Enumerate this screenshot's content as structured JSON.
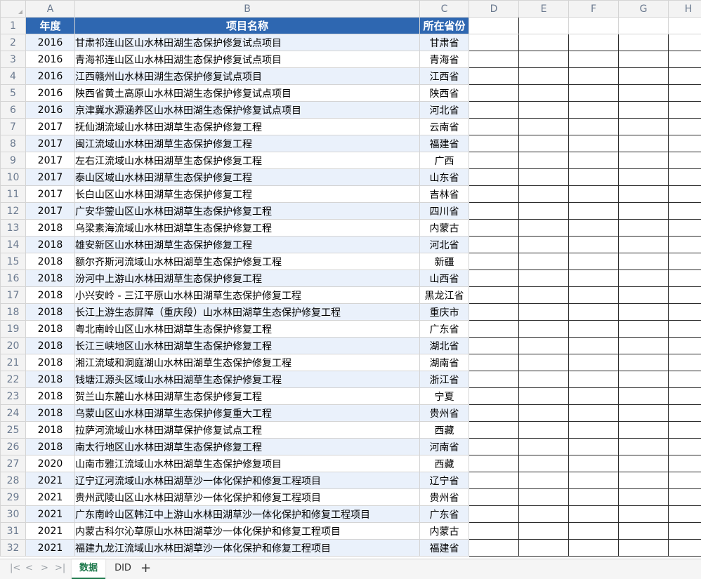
{
  "columns": [
    "A",
    "B",
    "C",
    "D",
    "E",
    "F",
    "G",
    "H"
  ],
  "headers": {
    "year": "年度",
    "name": "项目名称",
    "province": "所在省份"
  },
  "rows": [
    {
      "n": "2",
      "year": "2016",
      "name": "甘肃祁连山区山水林田湖生态保护修复试点项目",
      "province": "甘肃省"
    },
    {
      "n": "3",
      "year": "2016",
      "name": "青海祁连山区山水林田湖生态保护修复试点项目",
      "province": "青海省"
    },
    {
      "n": "4",
      "year": "2016",
      "name": "江西赣州山水林田湖生态保护修复试点项目",
      "province": "江西省"
    },
    {
      "n": "5",
      "year": "2016",
      "name": "陕西省黄土高原山水林田湖生态保护修复试点项目",
      "province": "陕西省"
    },
    {
      "n": "6",
      "year": "2016",
      "name": "京津冀水源涵养区山水林田湖生态保护修复试点项目",
      "province": "河北省"
    },
    {
      "n": "7",
      "year": "2017",
      "name": "抚仙湖流域山水林田湖草生态保护修复工程",
      "province": "云南省"
    },
    {
      "n": "8",
      "year": "2017",
      "name": "闽江流域山水林田湖草生态保护修复工程",
      "province": "福建省"
    },
    {
      "n": "9",
      "year": "2017",
      "name": "左右江流域山水林田湖草生态保护修复工程",
      "province": "广西"
    },
    {
      "n": "10",
      "year": "2017",
      "name": "泰山区域山水林田湖草生态保护修复工程",
      "province": "山东省"
    },
    {
      "n": "11",
      "year": "2017",
      "name": "长白山区山水林田湖草生态保护修复工程",
      "province": "吉林省"
    },
    {
      "n": "12",
      "year": "2017",
      "name": "广安华蓥山区山水林田湖草生态保护修复工程",
      "province": "四川省"
    },
    {
      "n": "13",
      "year": "2018",
      "name": "乌梁素海流域山水林田湖草生态保护修复工程",
      "province": "内蒙古"
    },
    {
      "n": "14",
      "year": "2018",
      "name": "雄安新区山水林田湖草生态保护修复工程",
      "province": "河北省"
    },
    {
      "n": "15",
      "year": "2018",
      "name": "额尔齐斯河流域山水林田湖草生态保护修复工程",
      "province": "新疆"
    },
    {
      "n": "16",
      "year": "2018",
      "name": "汾河中上游山水林田湖草生态保护修复工程",
      "province": "山西省"
    },
    {
      "n": "17",
      "year": "2018",
      "name": "小兴安岭 - 三江平原山水林田湖草生态保护修复工程",
      "province": "黑龙江省"
    },
    {
      "n": "18",
      "year": "2018",
      "name": "长江上游生态屏障（重庆段）山水林田湖草生态保护修复工程",
      "province": "重庆市"
    },
    {
      "n": "19",
      "year": "2018",
      "name": "粤北南岭山区山水林田湖草生态保护修复工程",
      "province": "广东省"
    },
    {
      "n": "20",
      "year": "2018",
      "name": "长江三峡地区山水林田湖草生态保护修复工程",
      "province": "湖北省"
    },
    {
      "n": "21",
      "year": "2018",
      "name": "湘江流域和洞庭湖山水林田湖草生态保护修复工程",
      "province": "湖南省"
    },
    {
      "n": "22",
      "year": "2018",
      "name": "钱塘江源头区域山水林田湖草生态保护修复工程",
      "province": "浙江省"
    },
    {
      "n": "23",
      "year": "2018",
      "name": "贺兰山东麓山水林田湖草生态保护修复工程",
      "province": "宁夏"
    },
    {
      "n": "24",
      "year": "2018",
      "name": "乌蒙山区山水林田湖草生态保护修复重大工程",
      "province": "贵州省"
    },
    {
      "n": "25",
      "year": "2018",
      "name": "拉萨河流域山水林田湖草保护修复试点工程",
      "province": "西藏"
    },
    {
      "n": "26",
      "year": "2018",
      "name": "南太行地区山水林田湖草生态保护修复工程",
      "province": "河南省"
    },
    {
      "n": "27",
      "year": "2020",
      "name": "山南市雅江流域山水林田湖草生态保护修复项目",
      "province": "西藏"
    },
    {
      "n": "28",
      "year": "2021",
      "name": "辽宁辽河流域山水林田湖草沙一体化保护和修复工程项目",
      "province": "辽宁省"
    },
    {
      "n": "29",
      "year": "2021",
      "name": "贵州武陵山区山水林田湖草沙一体化保护和修复工程项目",
      "province": "贵州省"
    },
    {
      "n": "30",
      "year": "2021",
      "name": "广东南岭山区韩江中上游山水林田湖草沙一体化保护和修复工程项目",
      "province": "广东省"
    },
    {
      "n": "31",
      "year": "2021",
      "name": "内蒙古科尔沁草原山水林田湖草沙一体化保护和修复工程项目",
      "province": "内蒙古"
    },
    {
      "n": "32",
      "year": "2021",
      "name": "福建九龙江流域山水林田湖草沙一体化保护和修复工程项目",
      "province": "福建省"
    }
  ],
  "sheet_tabs": {
    "active": "数据",
    "other": "DID",
    "add": "+"
  },
  "nav_icons": [
    "first-sheet-icon",
    "prev-sheet-icon",
    "next-sheet-icon",
    "last-sheet-icon"
  ]
}
